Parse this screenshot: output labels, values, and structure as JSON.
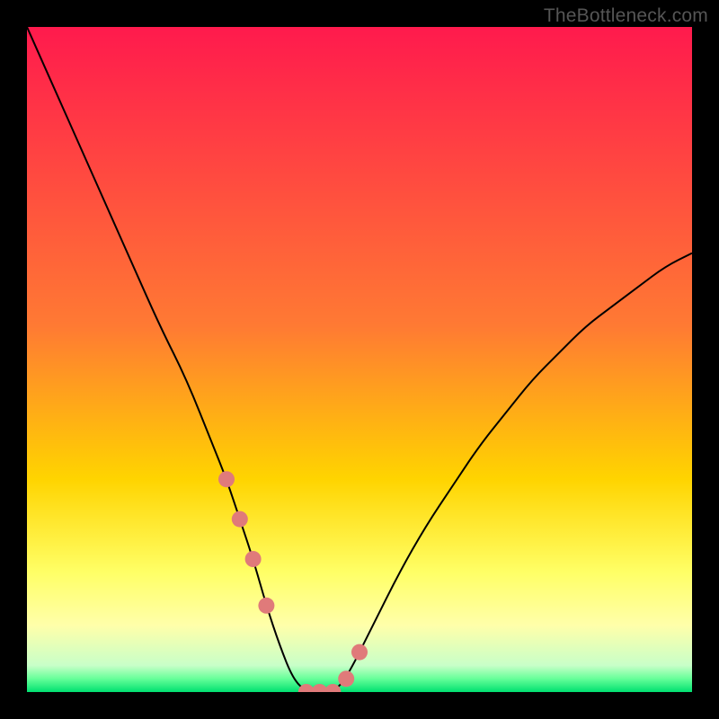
{
  "watermark": "TheBottleneck.com",
  "chart_data": {
    "type": "line",
    "title": "",
    "xlabel": "",
    "ylabel": "",
    "xlim": [
      0,
      100
    ],
    "ylim": [
      0,
      100
    ],
    "background_gradient_stops": [
      {
        "pos": 0.0,
        "color": "#ff1a4d"
      },
      {
        "pos": 0.45,
        "color": "#ff7a33"
      },
      {
        "pos": 0.68,
        "color": "#ffd400"
      },
      {
        "pos": 0.82,
        "color": "#ffff66"
      },
      {
        "pos": 0.9,
        "color": "#ffffaa"
      },
      {
        "pos": 0.96,
        "color": "#c8ffc8"
      },
      {
        "pos": 0.98,
        "color": "#66ff99"
      },
      {
        "pos": 1.0,
        "color": "#00e070"
      }
    ],
    "series": [
      {
        "name": "bottleneck-curve",
        "color": "#000000",
        "stroke_width": 2,
        "x": [
          0,
          4,
          8,
          12,
          16,
          20,
          24,
          28,
          30,
          32,
          34,
          36,
          38,
          40,
          42,
          44,
          46,
          48,
          52,
          56,
          60,
          64,
          68,
          72,
          76,
          80,
          84,
          88,
          92,
          96,
          100
        ],
        "y": [
          100,
          91,
          82,
          73,
          64,
          55,
          47,
          37,
          32,
          26,
          20,
          13,
          7,
          2,
          0,
          0,
          0,
          2,
          10,
          18,
          25,
          31,
          37,
          42,
          47,
          51,
          55,
          58,
          61,
          64,
          66
        ]
      }
    ],
    "highlight_points": {
      "name": "selected-range",
      "color": "#e07a7a",
      "radius": 9,
      "x": [
        30,
        32,
        34,
        36,
        42,
        44,
        46,
        48,
        50
      ],
      "y": [
        32,
        26,
        20,
        13,
        0,
        0,
        0,
        2,
        6
      ]
    }
  }
}
